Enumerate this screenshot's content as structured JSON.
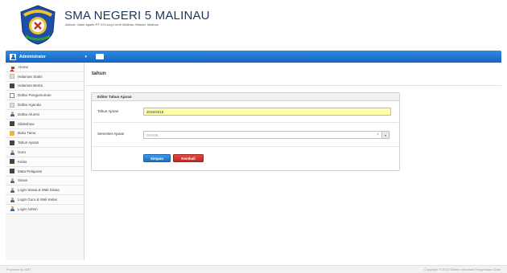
{
  "header": {
    "school_name": "SMA NEGERI 5 MALINAU",
    "address": "Alamat: Jalan Agatis RT VII Long Loreh Malinau Selatan, Malinau"
  },
  "topbar": {
    "user_label": "Administrator",
    "caret": "▾"
  },
  "sidebar": {
    "items": [
      {
        "label": "Home",
        "icon": "home-icon"
      },
      {
        "label": "Halaman Statis",
        "icon": "page-icon"
      },
      {
        "label": "Halaman Berita",
        "icon": "list-icon"
      },
      {
        "label": "Daftar Pengumuman",
        "icon": "document-icon"
      },
      {
        "label": "Daftar Agenda",
        "icon": "page-icon"
      },
      {
        "label": "Daftar Alumni",
        "icon": "user-icon"
      },
      {
        "label": "Slideshow",
        "icon": "list-icon"
      },
      {
        "label": "Buku Tamu",
        "icon": "book-icon"
      },
      {
        "label": "Tahun Ajaran",
        "icon": "list-icon"
      },
      {
        "label": "Guru",
        "icon": "user-icon"
      },
      {
        "label": "Kelas",
        "icon": "list-icon"
      },
      {
        "label": "Mata Pelajaran",
        "icon": "list-icon"
      },
      {
        "label": "Siswa",
        "icon": "user-icon"
      },
      {
        "label": "Login Siswa & Wali Siswa",
        "icon": "user-icon"
      },
      {
        "label": "Login Guru & Wali Kelas",
        "icon": "user-icon"
      },
      {
        "label": "Login Admin",
        "icon": "user-icon"
      }
    ]
  },
  "main": {
    "page_title": "tahun",
    "panel_title": "Editor Tahun Ajaran",
    "tahun_label": "Tahun Ajaran",
    "tahun_value": "2015/2016",
    "semester_label": "Semester Ajaran",
    "semester_value": "GANJIL",
    "clear_symbol": "×",
    "arrow_symbol": "▾",
    "save_label": "Simpan",
    "back_label": "Kembali"
  },
  "footer": {
    "left": "Powered by SMT",
    "right": "Copyright © 2015 Sistem Informasi Pengelolaan Data"
  },
  "colors": {
    "topbar": "#1e78d6",
    "save_button": "#2a82d8",
    "back_button": "#d23a34",
    "input_highlight": "#ffffa8"
  }
}
